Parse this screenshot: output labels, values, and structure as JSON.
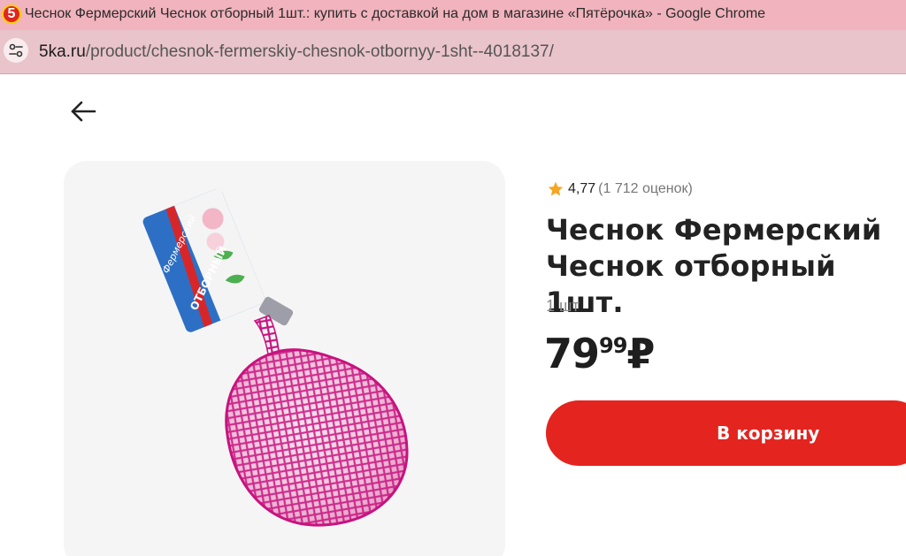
{
  "browser": {
    "window_title": "Чеснок Фермерский Чеснок отборный 1шт.: купить с доставкой на дом в магазине «Пятёрочка» - Google Chrome",
    "favicon_text": "5",
    "url_host": "5ka.ru",
    "url_path": "/product/chesnok-fermerskiy-chesnok-otbornyy-1sht--4018137/"
  },
  "product": {
    "rating_score": "4,77",
    "rating_count": "(1 712 оценок)",
    "title": "Чеснок Фермерский Чеснок отборный 1шт.",
    "unit": "1 шт",
    "price_rub": "79",
    "price_kop": "99",
    "currency": "₽",
    "add_to_cart_label": "В корзину",
    "package_brand": "Фермерский",
    "package_label": "ОТБОРНЫЙ"
  },
  "icons": {
    "back": "arrow-left-icon",
    "star": "star-icon",
    "site_info": "tune-icon"
  },
  "colors": {
    "accent_red": "#e3241f",
    "star": "#f5a623",
    "titlebar_bg": "#f1b3bd",
    "addressbar_bg": "#e9c4ca"
  }
}
